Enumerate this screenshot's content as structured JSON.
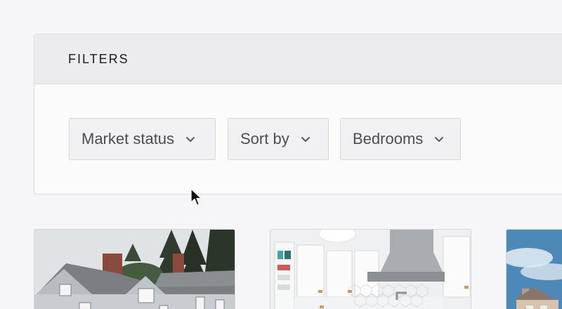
{
  "filters": {
    "title": "FILTERS",
    "dropdowns": [
      {
        "label": "Market status",
        "icon": "chevron-down-icon"
      },
      {
        "label": "Sort by",
        "icon": "chevron-down-icon"
      },
      {
        "label": "Bedrooms",
        "icon": "chevron-down-icon"
      }
    ]
  },
  "listings": [
    {
      "image": "house-exterior-photo"
    },
    {
      "image": "kitchen-interior-photo"
    },
    {
      "image": "house-exterior-sky-photo"
    }
  ],
  "colors": {
    "page_bg": "#f6f6f8",
    "header_bg": "#ececee",
    "dropdown_bg": "#f1f1f3",
    "text_dark": "#1b1b1f",
    "text_muted": "#4c4c52"
  }
}
